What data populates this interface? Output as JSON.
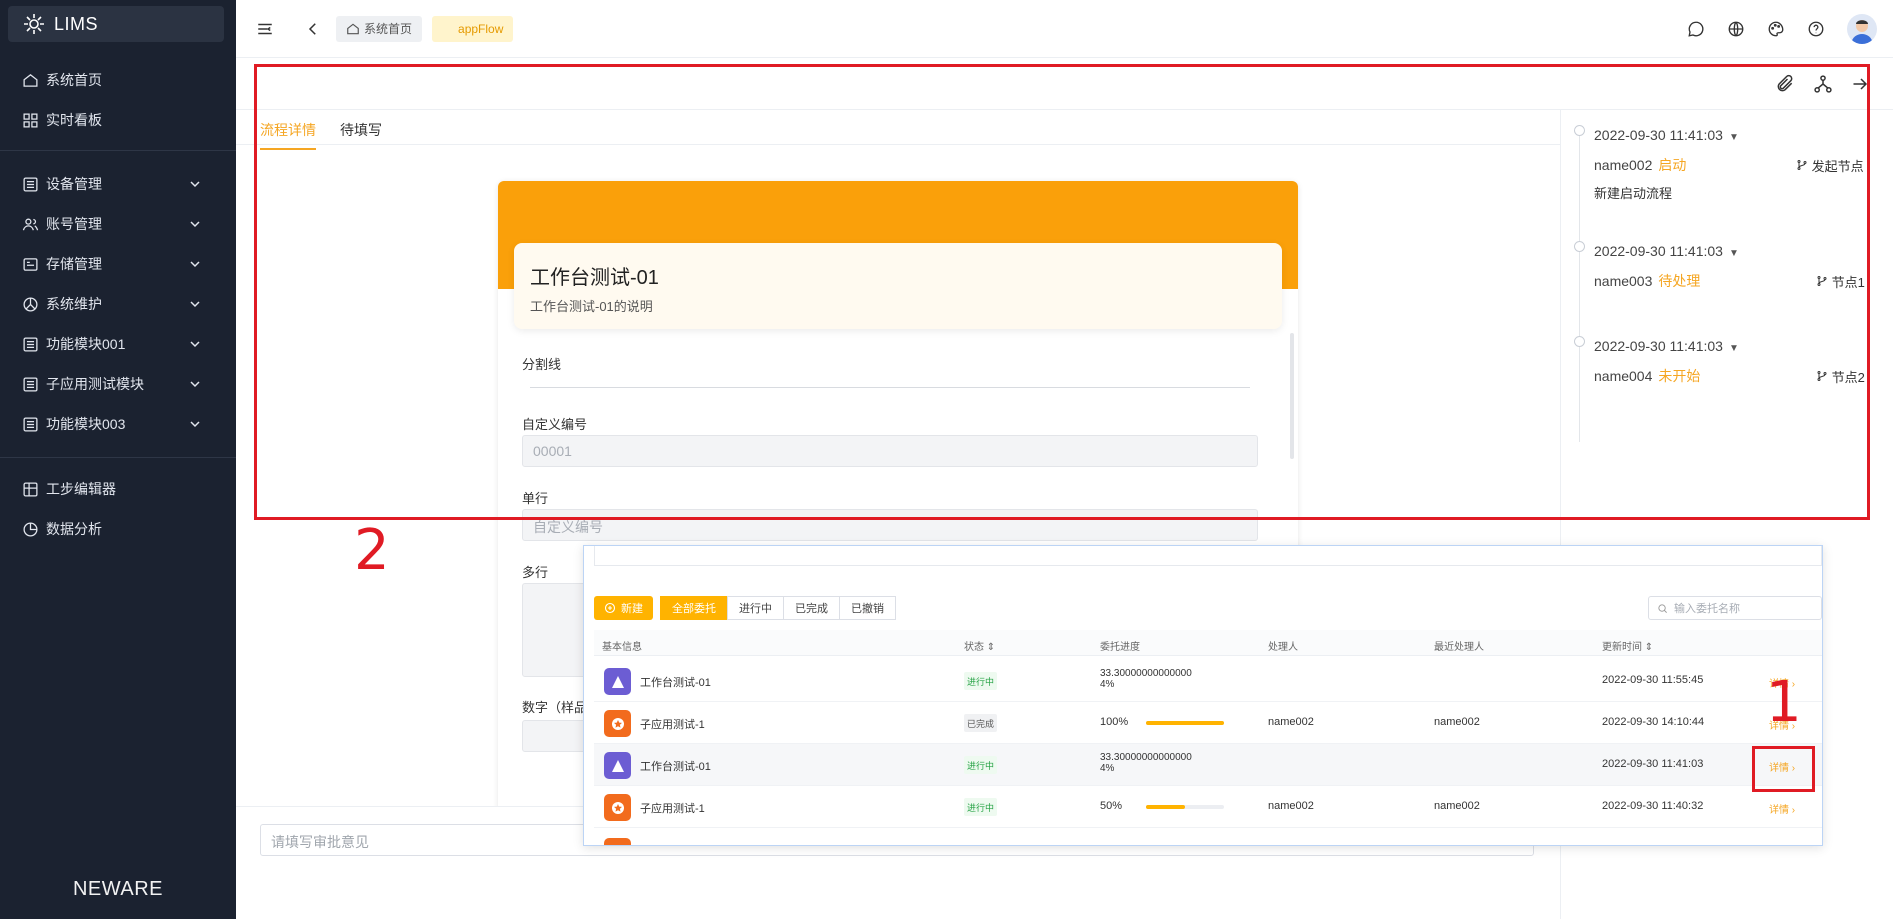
{
  "sidebar": {
    "brand": "LIMS",
    "items": [
      {
        "label": "系统首页",
        "icon": "home-icon"
      },
      {
        "label": "实时看板",
        "icon": "dashboard-icon"
      },
      {
        "label": "设备管理",
        "icon": "module-icon"
      },
      {
        "label": "账号管理",
        "icon": "users-icon"
      },
      {
        "label": "存储管理",
        "icon": "storage-icon"
      },
      {
        "label": "系统维护",
        "icon": "maintenance-icon"
      },
      {
        "label": "功能模块001",
        "icon": "module-icon"
      },
      {
        "label": "子应用测试模块",
        "icon": "module-icon"
      },
      {
        "label": "功能模块003",
        "icon": "module-icon"
      },
      {
        "label": "工步编辑器",
        "icon": "grid-icon"
      },
      {
        "label": "数据分析",
        "icon": "chart-pie-icon"
      }
    ],
    "footer": "NEWARE"
  },
  "header": {
    "breadcrumb_home": "系统首页",
    "breadcrumb_app": "appFlow"
  },
  "tabs": [
    "流程详情",
    "待填写"
  ],
  "form": {
    "title": "工作台测试-01",
    "description": "工作台测试-01的说明",
    "divider_label": "分割线",
    "field_custom_no_label": "自定义编号",
    "field_custom_no_value": "00001",
    "field_single_label": "单行",
    "field_single_placeholder": "自定义编号",
    "field_multi_label": "多行",
    "field_number_label": "数字（样品"
  },
  "comment_placeholder": "请填写审批意见",
  "timeline": [
    {
      "time": "2022-09-30 11:41:03",
      "user": "name002",
      "status": "启动",
      "node": "发起节点",
      "note": "新建启动流程"
    },
    {
      "time": "2022-09-30 11:41:03",
      "user": "name003",
      "status": "待处理",
      "node": "节点1",
      "note": ""
    },
    {
      "time": "2022-09-30 11:41:03",
      "user": "name004",
      "status": "未开始",
      "node": "节点2",
      "note": ""
    }
  ],
  "annotations": {
    "box1": "1",
    "box2": "2"
  },
  "overlay": {
    "new_button": "新建",
    "filters": [
      "全部委托",
      "进行中",
      "已完成",
      "已撤销"
    ],
    "search_placeholder": "输入委托名称",
    "columns": [
      "基本信息",
      "状态",
      "委托进度",
      "处理人",
      "最近处理人",
      "更新时间"
    ],
    "rows": [
      {
        "name": "工作台测试-01",
        "icon": "triangle-app-icon",
        "status": "进行中",
        "progress_text": "33.30000000000000\n4%",
        "progress": null,
        "handler": "",
        "last_handler": "",
        "updated": "2022-09-30 11:55:45",
        "detail": "详情"
      },
      {
        "name": "子应用测试-1",
        "icon": "star-app-icon",
        "status": "已完成",
        "progress_text": "100%",
        "progress": 1.0,
        "handler": "name002",
        "last_handler": "name002",
        "updated": "2022-09-30 14:10:44",
        "detail": "详情"
      },
      {
        "name": "工作台测试-01",
        "icon": "triangle-app-icon",
        "status": "进行中",
        "progress_text": "33.30000000000000\n4%",
        "progress": null,
        "handler": "",
        "last_handler": "",
        "updated": "2022-09-30 11:41:03",
        "detail": "详情"
      },
      {
        "name": "子应用测试-1",
        "icon": "star-app-icon",
        "status": "进行中",
        "progress_text": "50%",
        "progress": 0.5,
        "handler": "name002",
        "last_handler": "name002",
        "updated": "2022-09-30 11:40:32",
        "detail": "详情"
      }
    ]
  },
  "colors": {
    "accent": "#f5a623",
    "banner": "#faa00a",
    "sidebar": "#1b2230",
    "annotation": "#e01b24"
  }
}
